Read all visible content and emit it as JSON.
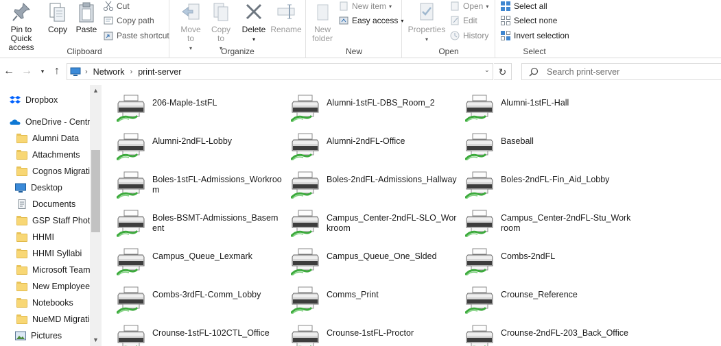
{
  "ribbon": {
    "clipboard": {
      "label": "Clipboard",
      "pin": "Pin to Quick access",
      "copy": "Copy",
      "paste": "Paste",
      "cut": "Cut",
      "copy_path": "Copy path",
      "paste_shortcut": "Paste shortcut"
    },
    "organize": {
      "label": "Organize",
      "move_to": "Move to",
      "copy_to": "Copy to",
      "delete": "Delete",
      "rename": "Rename"
    },
    "new": {
      "label": "New",
      "new_folder": "New folder",
      "new_item": "New item",
      "easy_access": "Easy access"
    },
    "open": {
      "label": "Open",
      "properties": "Properties",
      "open": "Open",
      "edit": "Edit",
      "history": "History"
    },
    "select": {
      "label": "Select",
      "select_all": "Select all",
      "select_none": "Select none",
      "invert": "Invert selection"
    }
  },
  "address": {
    "crumbs": [
      "Network",
      "print-server"
    ],
    "search_placeholder": "Search print-server"
  },
  "sidebar": {
    "items": [
      {
        "label": "Dropbox",
        "icon": "dropbox-icon"
      },
      {
        "label": "OneDrive - Centre",
        "icon": "onedrive-icon"
      },
      {
        "label": "Alumni Data",
        "icon": "folder-icon"
      },
      {
        "label": "Attachments",
        "icon": "folder-icon"
      },
      {
        "label": "Cognos Migratic",
        "icon": "folder-icon"
      },
      {
        "label": "Desktop",
        "icon": "desktop-icon"
      },
      {
        "label": "Documents",
        "icon": "documents-icon"
      },
      {
        "label": "GSP Staff Photos",
        "icon": "folder-icon"
      },
      {
        "label": "HHMI",
        "icon": "folder-icon"
      },
      {
        "label": "HHMI Syllabi",
        "icon": "folder-icon"
      },
      {
        "label": "Microsoft Teams",
        "icon": "folder-icon"
      },
      {
        "label": "New Employees",
        "icon": "folder-icon"
      },
      {
        "label": "Notebooks",
        "icon": "folder-icon"
      },
      {
        "label": "NueMD Migratic",
        "icon": "folder-icon"
      },
      {
        "label": "Pictures",
        "icon": "pictures-icon"
      }
    ]
  },
  "printers": [
    "206-Maple-1stFL",
    "Alumni-1stFL-DBS_Room_2",
    "Alumni-1stFL-Hall",
    "Alumni-2ndFL-Lobby",
    "Alumni-2ndFL-Office",
    "Baseball",
    "Boles-1stFL-Admissions_Workroom",
    "Boles-2ndFL-Admissions_Hallway",
    "Boles-2ndFL-Fin_Aid_Lobby",
    "Boles-BSMT-Admissions_Basement",
    "Campus_Center-2ndFL-SLO_Workroom",
    "Campus_Center-2ndFL-Stu_Workroom",
    "Campus_Queue_Lexmark",
    "Campus_Queue_One_Slded",
    "Combs-2ndFL",
    "Combs-3rdFL-Comm_Lobby",
    "Comms_Print",
    "Crounse_Reference",
    "Crounse-1stFL-102CTL_Office",
    "Crounse-1stFL-Proctor",
    "Crounse-2ndFL-203_Back_Office"
  ],
  "colors": {
    "accent": "#0063b1",
    "folder": "#f8d775",
    "printer_cable": "#3caa3c"
  }
}
